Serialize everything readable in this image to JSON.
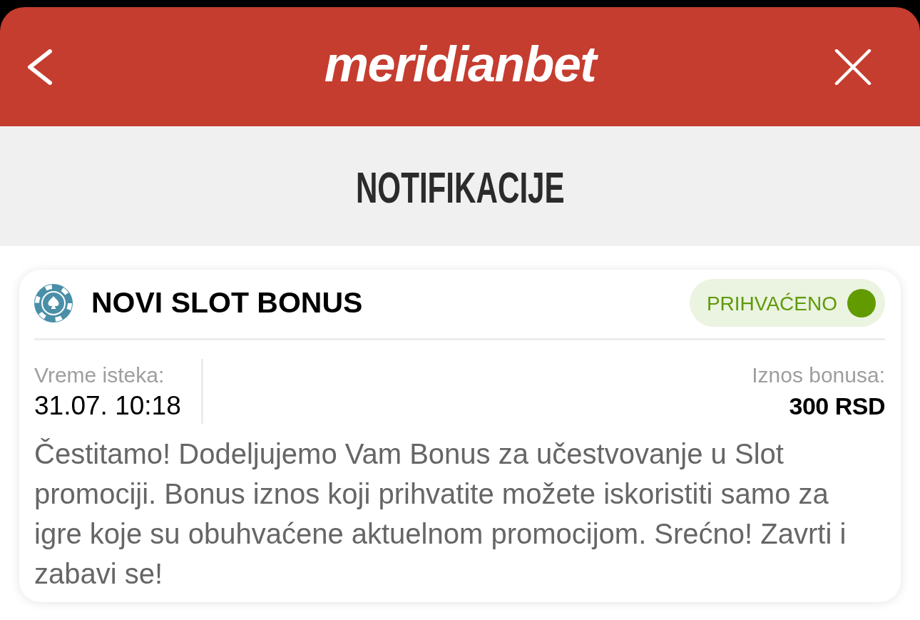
{
  "header": {
    "logo": "meridianbet"
  },
  "page_title": "NOTIFIKACIJE",
  "notifications": [
    {
      "title": "NOVI SLOT BONUS",
      "status": {
        "label": "PRIHVAĆENO",
        "kind": "accepted"
      },
      "expiry": {
        "label": "Vreme isteka:",
        "value": "31.07. 10:18"
      },
      "amount": {
        "label": "Iznos bonusa:",
        "value": "300 RSD"
      },
      "message": "Čestitamo! Dodeljujemo Vam Bonus za učestvovanje u Slot promociji. Bonus iznos koji prihvatite možete iskoristiti samo za igre koje su obuhvaćene aktuelnom promocijom. Srećno! Zavrti i zabavi se!"
    }
  ]
}
